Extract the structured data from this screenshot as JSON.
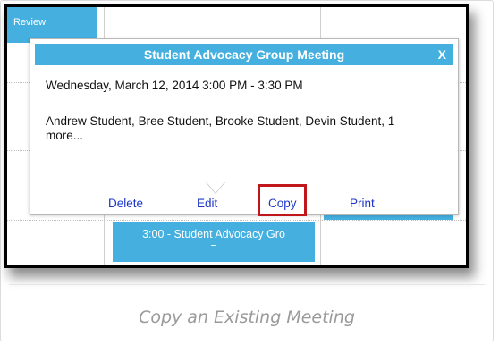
{
  "calendar": {
    "review_label": "Review",
    "meeting_block_label": "3:00 - Student Advocacy Gro",
    "meeting_block_dash": "=",
    "right_block_dash": "="
  },
  "popup": {
    "title": "Student Advocacy Group Meeting",
    "close_label": "X",
    "datetime": "Wednesday, March 12, 2014 3:00 PM - 3:30 PM",
    "attendees": "Andrew Student, Bree Student, Brooke Student, Devin Student, 1 more...",
    "actions": {
      "delete": "Delete",
      "edit": "Edit",
      "copy": "Copy",
      "print": "Print"
    }
  },
  "caption": "Copy an Existing Meeting",
  "colors": {
    "accent_blue": "#45b0e0",
    "link_blue": "#1b35c8",
    "highlight_red": "#c0161c"
  }
}
